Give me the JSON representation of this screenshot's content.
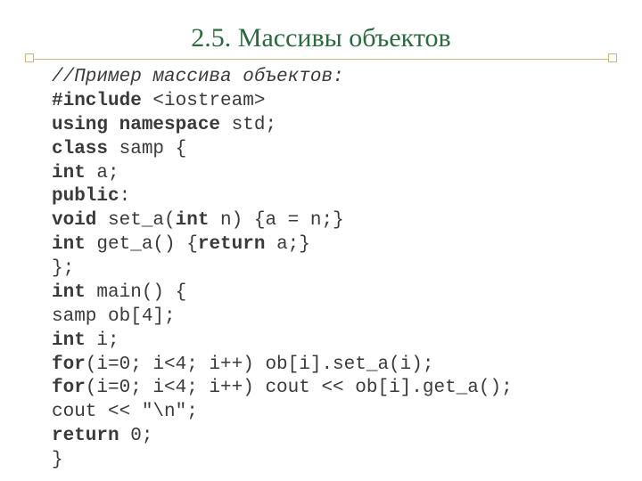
{
  "title": "2.5. Массивы объектов",
  "code": {
    "l1": "//Пример массива объектов:",
    "l2a": "#include",
    "l2b": " <iostream>",
    "l3a": "using namespace",
    "l3b": " std;",
    "l4a": "class",
    "l4b": " samp {",
    "l5a": "int",
    "l5b": " a;",
    "l6": "public",
    "l6b": ":",
    "l7a": "void",
    "l7b": " set_a(",
    "l7c": "int",
    "l7d": " n) {a = n;}",
    "l8a": "int",
    "l8b": " get_a() {",
    "l8c": "return",
    "l8d": " a;}",
    "l9": "};",
    "l10a": "int",
    "l10b": " main() {",
    "l11": "samp ob[4];",
    "l12a": "int",
    "l12b": " i;",
    "l13a": "for",
    "l13b": "(i=0; i<4; i++) ob[i].set_a(i);",
    "l14a": "for",
    "l14b": "(i=0; i<4; i++) cout << ob[i].get_a();",
    "l15": "cout << \"\\n\";",
    "l16a": "return",
    "l16b": " 0;",
    "l17": "}"
  }
}
